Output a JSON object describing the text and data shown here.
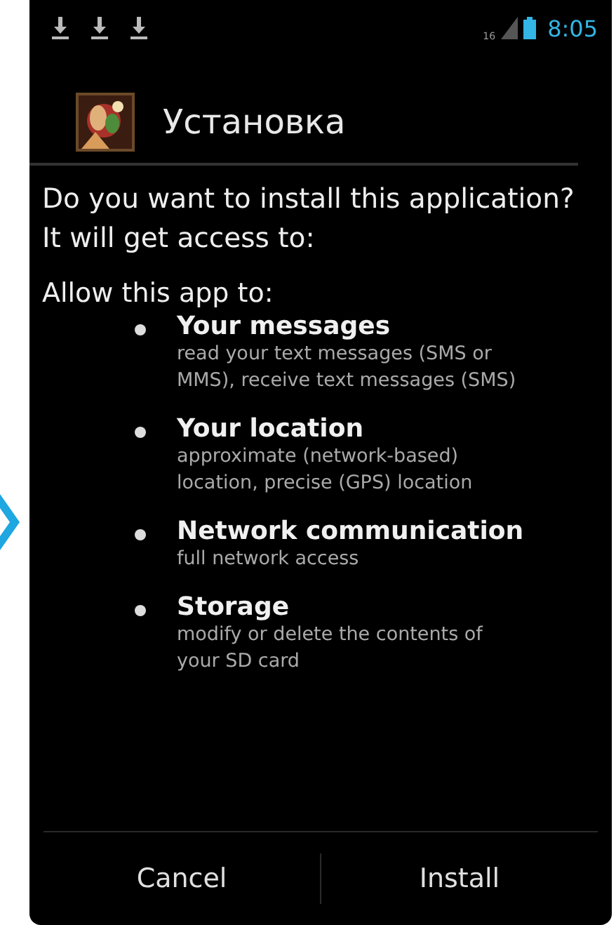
{
  "status_bar": {
    "notifications": [
      {
        "kind": "download"
      },
      {
        "kind": "download"
      },
      {
        "kind": "download"
      }
    ],
    "network_label": "16",
    "time": "8:05"
  },
  "title": "Установка",
  "app_icon": {
    "kind": "picture"
  },
  "prompt": "Do you want to install this application? It will get access to:",
  "allow_heading": "Allow this app to:",
  "permissions": [
    {
      "title": "Your messages",
      "description": "read your text messages (SMS or MMS), receive text messages (SMS)"
    },
    {
      "title": "Your location",
      "description": "approximate (network-based) location, precise (GPS) location"
    },
    {
      "title": "Network communication",
      "description": "full network access"
    },
    {
      "title": "Storage",
      "description": "modify or delete the contents of your SD card"
    }
  ],
  "buttons": [
    "Cancel",
    "Install"
  ]
}
